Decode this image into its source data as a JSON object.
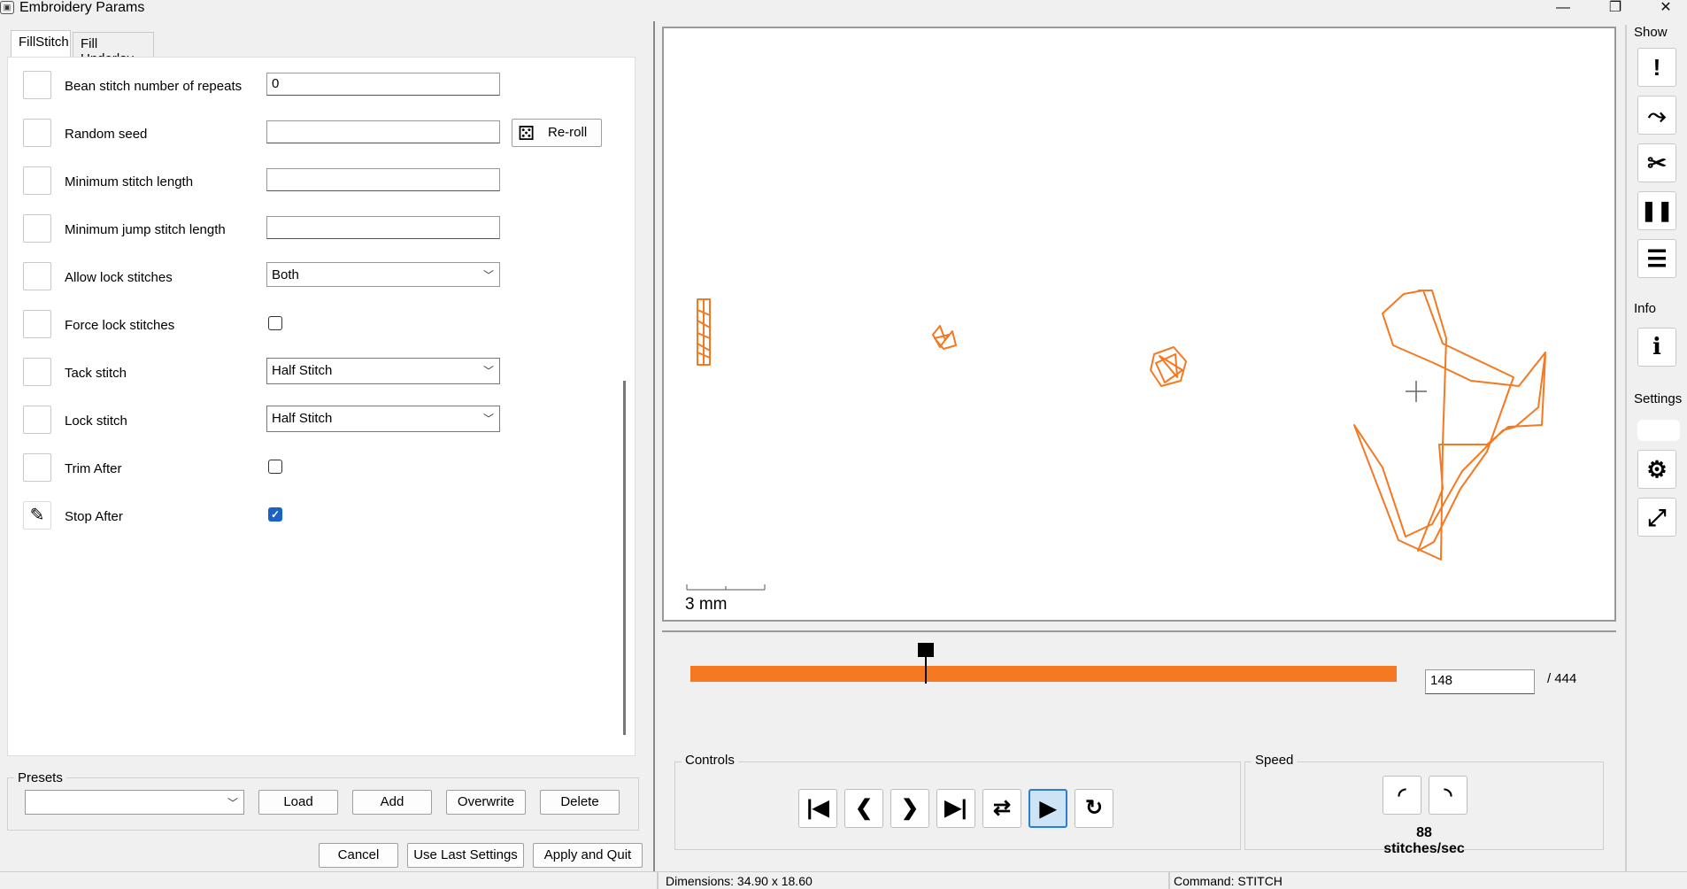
{
  "window": {
    "title": "Embroidery Params",
    "minimize": "—",
    "restore": "❐",
    "close": "✕"
  },
  "tabs": [
    {
      "label": "FillStitch",
      "active": true
    },
    {
      "label": "Fill Underlay",
      "active": false
    }
  ],
  "params": {
    "bean_label": "Bean stitch number of repeats",
    "bean_value": "0",
    "seed_label": "Random seed",
    "seed_value": "",
    "reroll_label": "Re-roll",
    "min_stitch_label": "Minimum stitch length",
    "min_stitch_value": "",
    "min_jump_label": "Minimum jump stitch length",
    "min_jump_value": "",
    "allow_lock_label": "Allow lock stitches",
    "allow_lock_value": "Both",
    "force_lock_label": "Force lock stitches",
    "force_lock_checked": false,
    "tack_label": "Tack stitch",
    "tack_value": "Half Stitch",
    "lock_label": "Lock stitch",
    "lock_value": "Half Stitch",
    "trim_label": "Trim After",
    "trim_checked": false,
    "stop_label": "Stop After",
    "stop_checked": true
  },
  "presets": {
    "title": "Presets",
    "selected": "",
    "load": "Load",
    "add": "Add",
    "overwrite": "Overwrite",
    "delete": "Delete"
  },
  "footer": {
    "cancel": "Cancel",
    "use_last": "Use Last Settings",
    "apply_quit": "Apply and Quit"
  },
  "simulator": {
    "scale_label": "3 mm",
    "current_stitch": "148",
    "total_stitches": "/ 444",
    "progress_fraction": 0.333,
    "stitch_color": "#f47920",
    "controls_title": "Controls",
    "speed_title": "Speed",
    "speed_value": "88 stitches/sec",
    "controls": [
      {
        "name": "first-stitch",
        "glyph": "|◀"
      },
      {
        "name": "prev-stitch",
        "glyph": "❮"
      },
      {
        "name": "next-stitch",
        "glyph": "❯"
      },
      {
        "name": "last-stitch",
        "glyph": "▶|"
      },
      {
        "name": "direction",
        "glyph": "⇄"
      },
      {
        "name": "play",
        "glyph": "▶"
      },
      {
        "name": "restart",
        "glyph": "↻"
      }
    ]
  },
  "sidebar": {
    "show_title": "Show",
    "info_title": "Info",
    "settings_title": "Settings",
    "show_buttons": [
      {
        "name": "errors",
        "glyph": "!"
      },
      {
        "name": "jumps",
        "glyph": "⤳"
      },
      {
        "name": "trims",
        "glyph": "✂"
      },
      {
        "name": "stops",
        "glyph": "❚❚"
      },
      {
        "name": "color-changes",
        "glyph": "☰"
      }
    ],
    "info_glyph": "i",
    "settings_glyph": "⚙",
    "expand_glyph": "⤢"
  },
  "status": {
    "dimensions": "Dimensions: 34.90 x 18.60",
    "command": "Command: STITCH"
  }
}
